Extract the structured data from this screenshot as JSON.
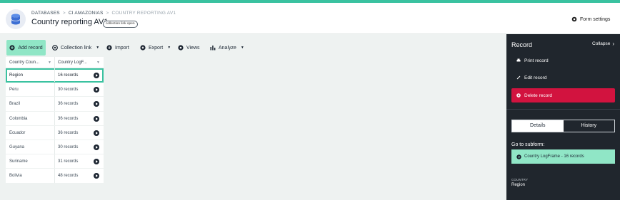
{
  "breadcrumb": {
    "items": [
      "DATABASES",
      "CI AMAZONIAS",
      "COUNTRY REPORTING AV1"
    ],
    "separator": ">"
  },
  "page": {
    "title": "Country reporting AV1",
    "badge": "collection link open"
  },
  "header": {
    "form_settings": "Form settings"
  },
  "toolbar": {
    "add_record": "Add record",
    "collection_link": "Collection link",
    "import": "Import",
    "export": "Export",
    "views": "Views",
    "analyze": "Analyze"
  },
  "table": {
    "columns": [
      "Country Coun...",
      "Country LogF..."
    ],
    "rows": [
      {
        "country": "Region",
        "records": "16 records"
      },
      {
        "country": "Peru",
        "records": "30 records"
      },
      {
        "country": "Brazil",
        "records": "36 records"
      },
      {
        "country": "Colombia",
        "records": "36 records"
      },
      {
        "country": "Ecuador",
        "records": "36 records"
      },
      {
        "country": "Guyana",
        "records": "30 records"
      },
      {
        "country": "Suriname",
        "records": "31 records"
      },
      {
        "country": "Bolivia",
        "records": "48 records"
      }
    ]
  },
  "panel": {
    "title": "Record",
    "collapse": "Collapse",
    "print": "Print record",
    "edit": "Edit record",
    "delete": "Delete record",
    "tabs": [
      "Details",
      "History"
    ],
    "subform_label": "Go to subform:",
    "subform_button": "Country LogFrame - 16 records",
    "field_label": "COUNTRY",
    "field_value": "Region"
  },
  "colors": {
    "accent": "#3ac2a0",
    "add_button": "#90e6c6",
    "delete": "#d2133f",
    "panel_bg": "#20262d"
  }
}
